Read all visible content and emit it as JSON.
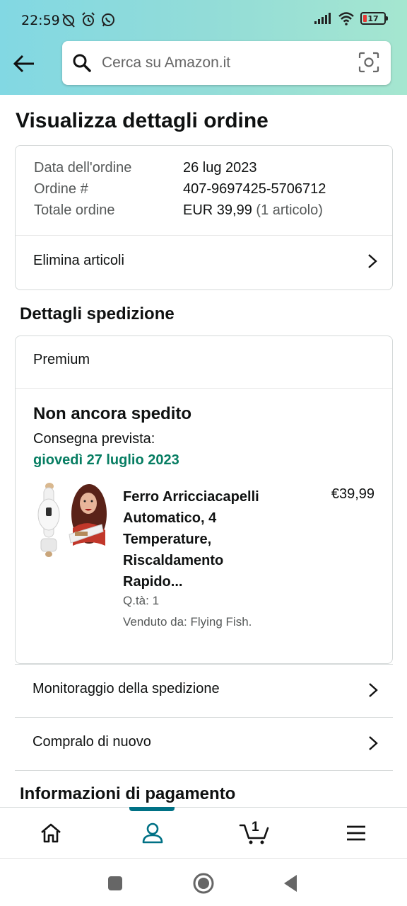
{
  "status_bar": {
    "time": "22:59",
    "battery_level": "17"
  },
  "search": {
    "placeholder": "Cerca su Amazon.it"
  },
  "page": {
    "title": "Visualizza dettagli ordine"
  },
  "order_summary": {
    "rows": [
      {
        "label": "Data dell'ordine",
        "value": "26 lug 2023",
        "extra": ""
      },
      {
        "label": "Ordine #",
        "value": "407-9697425-5706712",
        "extra": ""
      },
      {
        "label": "Totale ordine",
        "value": "EUR 39,99",
        "extra": "(1 articolo)"
      }
    ],
    "delete_items_label": "Elimina articoli"
  },
  "shipping": {
    "section_title": "Dettagli spedizione",
    "shipping_type": "Premium",
    "status": "Non ancora spedito",
    "delivery_label": "Consegna prevista:",
    "delivery_date": "giovedì 27 luglio 2023",
    "colors": {
      "delivery_date": "#067d62"
    },
    "item": {
      "title": "Ferro Arricciacapelli Automatico, 4 Temperature, Riscaldamento Rapido...",
      "price": "€39,99",
      "quantity": "Q.tà: 1",
      "seller": "Venduto da: Flying Fish."
    }
  },
  "actions": {
    "track_shipment": "Monitoraggio della spedizione",
    "buy_again": "Compralo di nuovo"
  },
  "payment": {
    "section_title": "Informazioni di pagamento"
  },
  "bottom_nav": {
    "items": [
      {
        "icon": "home-icon"
      },
      {
        "icon": "account-icon",
        "active": true
      },
      {
        "icon": "cart-icon",
        "count": "1"
      },
      {
        "icon": "menu-icon"
      }
    ],
    "accent_color": "#007185"
  }
}
